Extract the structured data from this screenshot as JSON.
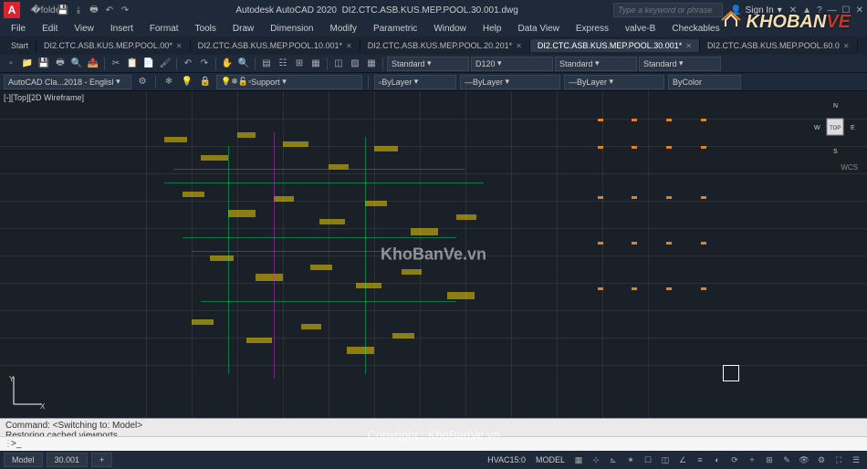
{
  "title": {
    "app": "Autodesk AutoCAD 2020",
    "file": "DI2.CTC.ASB.KUS.MEP.POOL.30.001.dwg",
    "search_placeholder": "Type a keyword or phrase",
    "signin": "Sign In"
  },
  "menus": [
    "File",
    "Edit",
    "View",
    "Insert",
    "Format",
    "Tools",
    "Draw",
    "Dimension",
    "Modify",
    "Parametric",
    "Window",
    "Help",
    "Data View",
    "Express",
    "valve-B",
    "Checkables"
  ],
  "tabs": [
    {
      "label": "Start",
      "active": false,
      "closable": false
    },
    {
      "label": "DI2.CTC.ASB.KUS.MEP.POOL.00*",
      "active": false,
      "closable": true
    },
    {
      "label": "DI2.CTC.ASB.KUS.MEP.POOL.10.001*",
      "active": false,
      "closable": true
    },
    {
      "label": "DI2.CTC.ASB.KUS.MEP.POOL.20.201*",
      "active": false,
      "closable": true
    },
    {
      "label": "DI2.CTC.ASB.KUS.MEP.POOL.30.001*",
      "active": true,
      "closable": true
    },
    {
      "label": "DI2.CTC.ASB.KUS.MEP.POOL.60.0",
      "active": false,
      "closable": true
    }
  ],
  "toolbar2": {
    "workspace": "AutoCAD Cla...2018 - Englisl",
    "layer_status": "Support",
    "props": {
      "color": "ByLayer",
      "linetype": "ByLayer",
      "lineweight": "ByLayer",
      "plotstyle": "ByColor"
    },
    "text_style": "Standard",
    "dim_style": "D120",
    "table_style": "Standard",
    "mleader_style": "Standard"
  },
  "viewport": {
    "label": "[-][Top][2D Wireframe]"
  },
  "viewcube": {
    "top": "TOP",
    "n": "N",
    "s": "S",
    "e": "E",
    "w": "W",
    "wcs": "WCS"
  },
  "command": {
    "line1": "Command:   <Switching to: Model>",
    "line2": "Restoring cached viewports.",
    "prompt": ">_"
  },
  "status": {
    "model": "Model",
    "layout": "30.001",
    "extra": "+",
    "scale": "HVAC15:0",
    "mode": "MODEL"
  },
  "watermarks": {
    "center": "KhoBanVe.vn",
    "copyright": "Copyright : KhoBanVe.vn",
    "logo_a": "KHOBAN",
    "logo_b": "VE"
  }
}
